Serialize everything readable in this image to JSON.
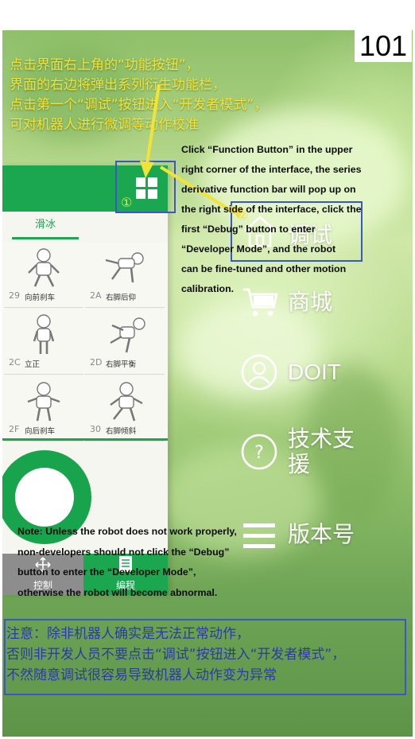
{
  "page_number": "101",
  "instruction_zh": [
    "点击界面右上角的“功能按钮”，",
    "界面的右边将弹出系列衍生功能栏，",
    "点击第一个“调试”按钮进入“开发者模式”，",
    "可对机器人进行微调等动作校准"
  ],
  "instruction_en": [
    "Click  “Function Button”  in the upper",
    "right corner of the interface, the series",
    "derivative function bar will pop up on",
    "the right side of the interface, click the",
    "first  “Debug”  button to enter",
    " “Developer Mode”, and the robot",
    "can be fine-tuned and other motion",
    "calibration."
  ],
  "markers": {
    "function_button": "①",
    "debug_button": "②"
  },
  "app": {
    "tab_label": "滑冰",
    "actions": [
      {
        "code": "29",
        "name": "向前刹车"
      },
      {
        "code": "2A",
        "name": "右脚后仰"
      },
      {
        "code": "2C",
        "name": "立正"
      },
      {
        "code": "2D",
        "name": "右脚平衡"
      },
      {
        "code": "2F",
        "name": "向后刹车"
      },
      {
        "code": "30",
        "name": "右脚倾斜"
      }
    ],
    "nav": {
      "control_label": "控制",
      "program_label": "编程"
    }
  },
  "menu": [
    {
      "icon": "house-icon",
      "label": "调试"
    },
    {
      "icon": "cart-icon",
      "label": "商城"
    },
    {
      "icon": "user-icon",
      "label": "DOIT"
    },
    {
      "icon": "help-icon",
      "label": "技术支援"
    },
    {
      "icon": "version-icon",
      "label": "版本号"
    }
  ],
  "note_en": [
    "Note: Unless the robot does not work properly,",
    "non-developers should not click the  “Debug”",
    "button to enter the  “Developer Mode”,",
    "otherwise the robot will become abnormal."
  ],
  "note_zh": [
    "注意：除非机器人确实是无法正常动作，",
    "否则非开发人员不要点击“调试”按钮进入“开发者模式”，",
    "不然随意调试很容易导致机器人动作变为异常"
  ],
  "colors": {
    "app_green": "#1aa74f",
    "annotation_yellow": "#f1e436",
    "annotation_blue": "#3a56c9",
    "note_text_blue": "#2c3aa5"
  }
}
